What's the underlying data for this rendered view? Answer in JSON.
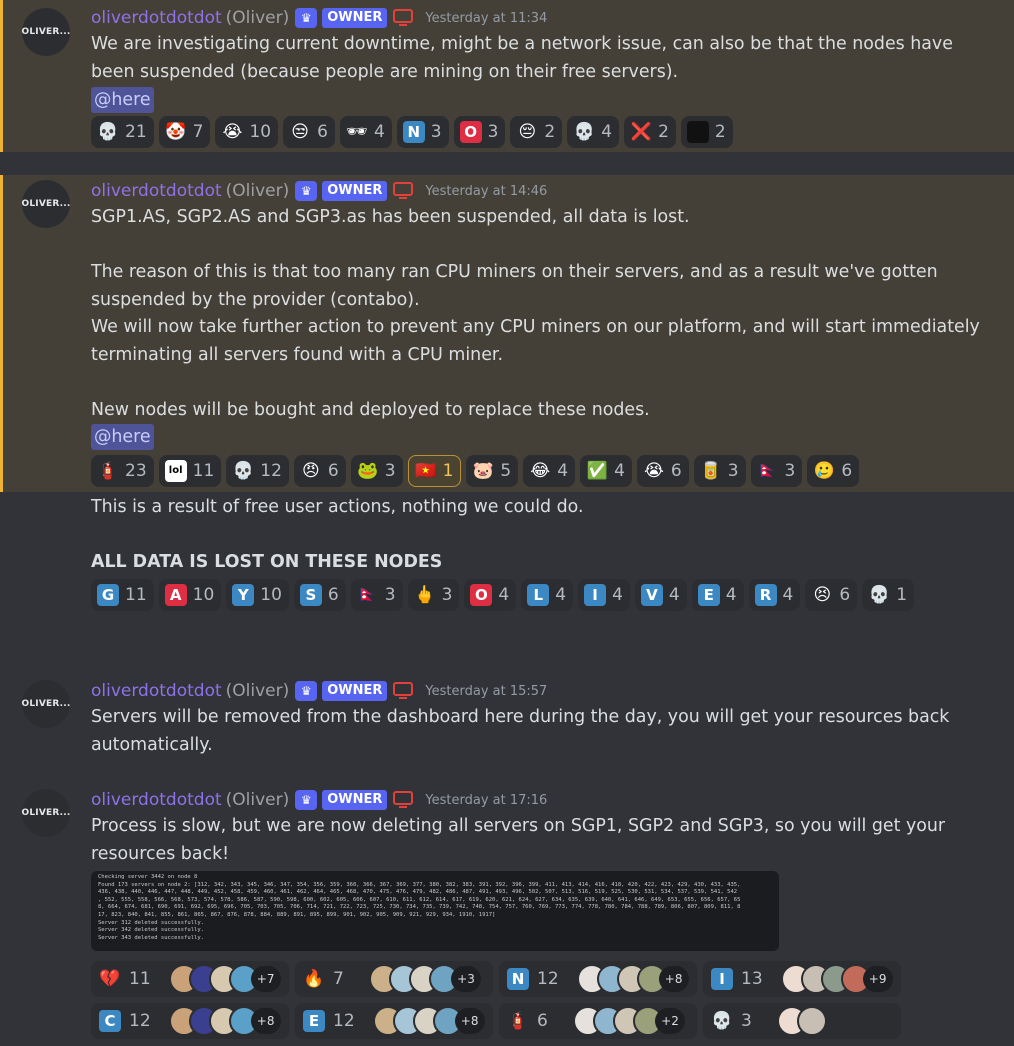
{
  "author": {
    "username": "oliverdotdotdot",
    "nickname": "(Oliver)",
    "role_badge": "OWNER",
    "avatar_text": "OLIVER..."
  },
  "colors": {
    "highlight_bg": "#444037",
    "highlight_bar": "#f0b232",
    "username": "#8e72e8",
    "owner_badge": "#5865f2",
    "mention_bg": "#4f5397"
  },
  "messages": [
    {
      "timestamp": "Yesterday at 11:34",
      "text": "We are investigating current downtime, might be a network issue, can also be that the nodes have been suspended (because people are mining on their free servers).",
      "mention": "@here",
      "reactions": [
        {
          "emoji": "💀",
          "count": "21"
        },
        {
          "emoji": "🤡",
          "count": "7"
        },
        {
          "emoji": "😭",
          "count": "10"
        },
        {
          "emoji": "😒",
          "count": "6"
        },
        {
          "emoji": "🕶",
          "count": "4"
        },
        {
          "emoji": "N",
          "count": "3"
        },
        {
          "emoji": "O",
          "count": "3"
        },
        {
          "emoji": "😔",
          "count": "2"
        },
        {
          "emoji": "💀",
          "count": "4"
        },
        {
          "emoji": "❌",
          "count": "2"
        },
        {
          "emoji": "▪",
          "count": "2"
        }
      ]
    },
    {
      "timestamp": "Yesterday at 14:46",
      "text": "SGP1.AS, SGP2.AS and SGP3.as has been suspended, all data is lost.\n\nThe reason of this is that too many ran CPU miners on their servers, and as a result we've gotten suspended by the provider (contabo).\nWe will now take further action to prevent any CPU miners on our platform, and will start immediately terminating all servers found with a CPU miner.\n\nNew nodes will be bought and deployed to replace these nodes.",
      "mention": "@here",
      "reactions": [
        {
          "emoji": "🧯",
          "count": "23"
        },
        {
          "emoji": "lol",
          "count": "11"
        },
        {
          "emoji": "💀",
          "count": "12"
        },
        {
          "emoji": "😠",
          "count": "6"
        },
        {
          "emoji": "🐸",
          "count": "3"
        },
        {
          "emoji": "🇻🇳",
          "count": "1",
          "me": true
        },
        {
          "emoji": "🐷",
          "count": "5"
        },
        {
          "emoji": "😂",
          "count": "4"
        },
        {
          "emoji": "✅",
          "count": "4"
        },
        {
          "emoji": "😭",
          "count": "6"
        },
        {
          "emoji": "🥫",
          "count": "3"
        },
        {
          "emoji": "🇳🇵",
          "count": "3"
        },
        {
          "emoji": "🥲",
          "count": "6"
        }
      ]
    },
    {
      "text": "This is a result of free user actions, nothing we could do.",
      "bold_text": "ALL DATA IS LOST ON THESE NODES",
      "reactions": [
        {
          "emoji": "G",
          "count": "11"
        },
        {
          "emoji": "A",
          "count": "10"
        },
        {
          "emoji": "Y",
          "count": "10"
        },
        {
          "emoji": "S",
          "count": "6"
        },
        {
          "emoji": "🇳🇵",
          "count": "3"
        },
        {
          "emoji": "🖕",
          "count": "3"
        },
        {
          "emoji": "O",
          "count": "4"
        },
        {
          "emoji": "L",
          "count": "4"
        },
        {
          "emoji": "I",
          "count": "4"
        },
        {
          "emoji": "V",
          "count": "4"
        },
        {
          "emoji": "E",
          "count": "4"
        },
        {
          "emoji": "R",
          "count": "4"
        },
        {
          "emoji": "😣",
          "count": "6"
        },
        {
          "emoji": "💀",
          "count": "1"
        }
      ]
    },
    {
      "timestamp": "Yesterday at 15:57",
      "text": "Servers will be removed from the dashboard here during the day, you will get your resources back automatically."
    },
    {
      "timestamp": "Yesterday at 17:16",
      "text": "Process is slow, but we are now deleting all servers on SGP1, SGP2 and SGP3, so you will get your resources back!",
      "screenshot_lines": [
        "Checking server 3442 on node 8",
        "Found 173 servers on node 2: [312, 342, 343, 345, 346, 347, 354, 356, 359, 360, 366, 367, 369, 377, 380, 382, 383, 391, 392, 396, 399, 411, 413, 414, 416, 418, 420, 422, 423, 429, 430, 433, 435,",
        " 436, 438, 440, 446, 447, 448, 449, 452, 458, 459, 460, 461, 462, 464, 465, 468, 470, 475, 476, 479, 482, 486, 487, 491, 493, 496, 502, 507, 513, 516, 519, 525, 530, 531, 534, 537, 539, 541, 542",
        ", 552, 555, 558, 566, 568, 573, 574, 578, 586, 587, 590, 598, 600, 602, 605, 606, 607, 610, 611, 612, 614, 617, 619, 620, 621, 624, 627, 634, 635, 639, 640, 641, 646, 649, 653, 655, 656, 657, 65",
        "8, 664, 674, 681, 690, 691, 692, 695, 696, 705, 703, 705, 706, 714, 721, 722, 723, 725, 730, 734, 735, 739, 742, 748, 754, 757, 760, 769, 773, 774, 778, 780, 784, 788, 789, 806, 807, 809, 811, 8",
        "17, 823, 840, 841, 855, 861, 865, 867, 876, 878, 884, 889, 891, 895, 899, 901, 902, 905, 909, 921, 929, 934, 1910, 1917]",
        "Server 312 deleted successfully.",
        "Server 342 deleted successfully.",
        "Server 343 deleted successfully."
      ],
      "poll_reactions": [
        {
          "emoji": "💔",
          "count": "11",
          "more": "+7"
        },
        {
          "emoji": "🔥",
          "count": "7",
          "more": "+3"
        },
        {
          "emoji": "N",
          "count": "12",
          "more": "+8"
        },
        {
          "emoji": "I",
          "count": "13",
          "more": "+9"
        },
        {
          "emoji": "C",
          "count": "12",
          "more": "+8"
        },
        {
          "emoji": "E",
          "count": "12",
          "more": "+8"
        },
        {
          "emoji": "🧯",
          "count": "6",
          "more": "+2"
        },
        {
          "emoji": "💀",
          "count": "3",
          "more": ""
        }
      ]
    }
  ]
}
